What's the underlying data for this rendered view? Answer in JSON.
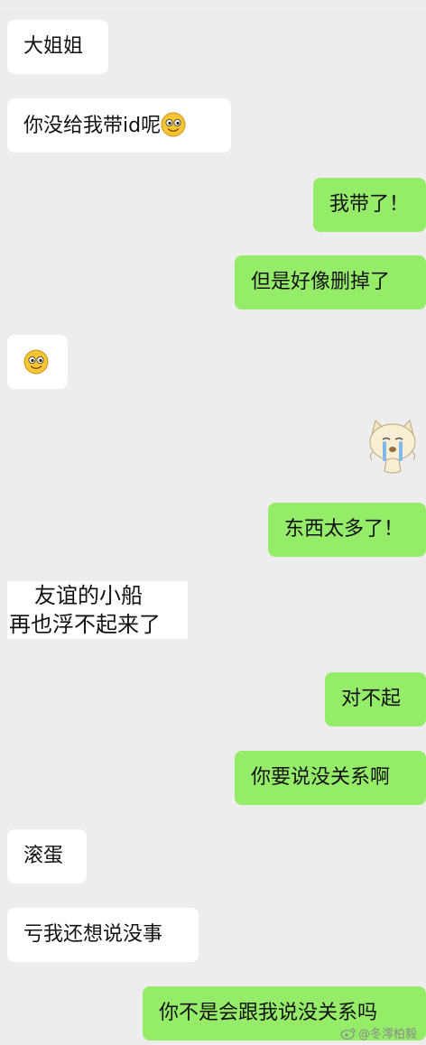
{
  "messages": [
    {
      "side": "in",
      "text": "大姐姐",
      "emoji": false
    },
    {
      "side": "in",
      "text": "你没给我带id呢",
      "emoji": true
    },
    {
      "side": "out",
      "text": "我带了！"
    },
    {
      "side": "out",
      "text": "但是好像删掉了"
    },
    {
      "side": "in",
      "text": "",
      "emoji": true
    },
    {
      "side": "out",
      "text": "东西太多了！"
    },
    {
      "side": "out",
      "text": "对不起"
    },
    {
      "side": "out",
      "text": "你要说没关系啊"
    },
    {
      "side": "in",
      "text": "滚蛋"
    },
    {
      "side": "in",
      "text": "亏我还想说没事"
    },
    {
      "side": "out",
      "text": "你不是会跟我说没关系吗"
    }
  ],
  "sticker": {
    "icon": "crying-cat-sticker-icon"
  },
  "caption": {
    "line1": "友谊的小船",
    "line2": "再也浮不起来了"
  },
  "watermark": {
    "text": "@冬澪柏毅"
  },
  "colors": {
    "background": "#ededed",
    "incoming": "#ffffff",
    "outgoing": "#95ec69"
  }
}
